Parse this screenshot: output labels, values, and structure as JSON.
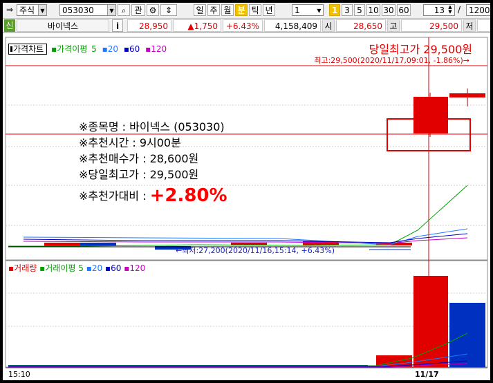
{
  "toolbar": {
    "market_type": "주식",
    "stock_code": "053030",
    "watch_label": "관",
    "period_buttons": [
      "일",
      "주",
      "월",
      "분",
      "틱",
      "년"
    ],
    "active_period": "분",
    "interval_value": "1",
    "minute_badge": "1",
    "minute_options": [
      "3",
      "5",
      "10",
      "30",
      "60"
    ],
    "count_value": "13",
    "slash": "/",
    "total_value": "1200"
  },
  "quote": {
    "tag": "신",
    "stock_name": "바이넥스",
    "info_label": "i",
    "price": "28,950",
    "change": "▲1,750",
    "change_pct": "+6.43%",
    "volume": "4,158,409",
    "open_label": "시",
    "open": "28,650",
    "high_label": "고",
    "high": "29,500",
    "low_label": "저"
  },
  "legend": {
    "price_chart": "가격차트",
    "price_ma_label": "가격이평",
    "ma_periods": [
      "5",
      "20",
      "60",
      "120"
    ]
  },
  "volume_legend": {
    "volume": "거래량",
    "volume_ma_label": "거래이평",
    "ma_periods": [
      "5",
      "20",
      "60",
      "120"
    ]
  },
  "annotations": {
    "headline": "당일최고가 29,500원",
    "high_note": "최고:29,500(2020/11/17,09:01, -1.86%)→",
    "low_note": "←최저:27,200(2020/11/16,15:14, +6.43%)",
    "info_lines": [
      "※종목명 : 바이넥스 (053030)",
      "※추천시간 : 9시00분",
      "※추천매수가 : 28,600원",
      "※당일최고가 : 29,500원"
    ],
    "ratio_label": "※추천가대비 : ",
    "ratio_value": "+2.80%"
  },
  "time_axis": [
    "15:10",
    "11/17"
  ],
  "colors": {
    "up": "#e00000",
    "down": "#0030c0",
    "ma5": "#00a000",
    "ma20": "#1e78ff",
    "ma60": "#0000c0",
    "ma120": "#c000c0"
  }
}
